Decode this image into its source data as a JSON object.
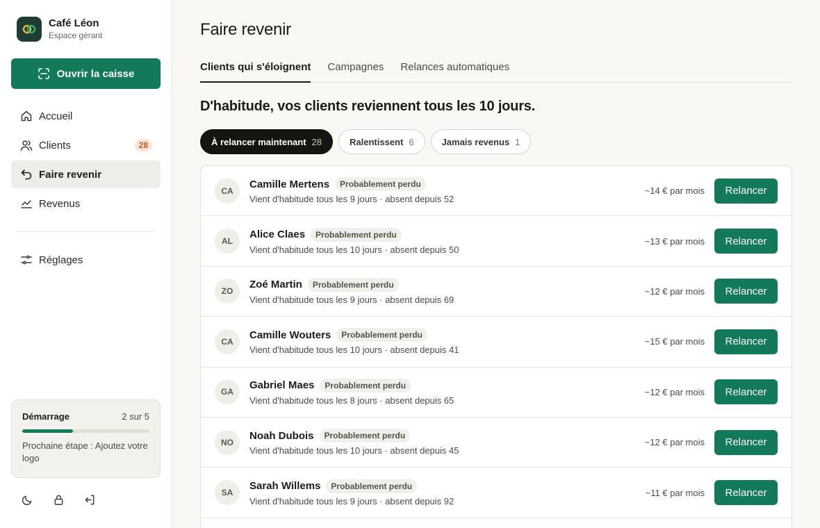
{
  "brand": {
    "name": "Café Léon",
    "subtitle": "Espace gérant",
    "colors": {
      "logo_bg": "#1f3d33",
      "accent": "#12795a"
    }
  },
  "cta": {
    "label": "Ouvrir la caisse",
    "icon": "scan-icon"
  },
  "nav": {
    "items": [
      {
        "label": "Accueil",
        "icon": "home-icon"
      },
      {
        "label": "Clients",
        "icon": "users-icon",
        "badge": "28"
      },
      {
        "label": "Faire revenir",
        "icon": "return-icon",
        "active": true
      },
      {
        "label": "Revenus",
        "icon": "chart-icon"
      }
    ],
    "settings": {
      "label": "Réglages",
      "icon": "sliders-icon"
    }
  },
  "onboarding": {
    "title": "Démarrage",
    "count": "2 sur 5",
    "progress": 0.4,
    "next": "Prochaine étape : Ajoutez votre logo"
  },
  "footer_icons": [
    "moon-icon",
    "lock-icon",
    "logout-icon"
  ],
  "page": {
    "title": "Faire revenir",
    "tabs": [
      {
        "label": "Clients qui s'éloignent",
        "active": true
      },
      {
        "label": "Campagnes"
      },
      {
        "label": "Relances automatiques"
      }
    ],
    "headline": "D'habitude, vos clients reviennent tous les 10 jours.",
    "filters": [
      {
        "label": "À relancer maintenant",
        "count": "28",
        "active": true
      },
      {
        "label": "Ralentissent",
        "count": "6"
      },
      {
        "label": "Jamais revenus",
        "count": "1"
      }
    ]
  },
  "clients": [
    {
      "initials": "CA",
      "name": "Camille Mertens",
      "tag": "Probablement perdu",
      "detail": "Vient d'habitude tous les 9 jours · absent depuis 52",
      "worth": "~14 € par mois",
      "action": "Relancer"
    },
    {
      "initials": "AL",
      "name": "Alice Claes",
      "tag": "Probablement perdu",
      "detail": "Vient d'habitude tous les 10 jours · absent depuis 50",
      "worth": "~13 € par mois",
      "action": "Relancer"
    },
    {
      "initials": "ZO",
      "name": "Zoé Martin",
      "tag": "Probablement perdu",
      "detail": "Vient d'habitude tous les 9 jours · absent depuis 69",
      "worth": "~12 € par mois",
      "action": "Relancer"
    },
    {
      "initials": "CA",
      "name": "Camille Wouters",
      "tag": "Probablement perdu",
      "detail": "Vient d'habitude tous les 10 jours · absent depuis 41",
      "worth": "~15 € par mois",
      "action": "Relancer"
    },
    {
      "initials": "GA",
      "name": "Gabriel Maes",
      "tag": "Probablement perdu",
      "detail": "Vient d'habitude tous les 8 jours · absent depuis 65",
      "worth": "~12 € par mois",
      "action": "Relancer"
    },
    {
      "initials": "NO",
      "name": "Noah Dubois",
      "tag": "Probablement perdu",
      "detail": "Vient d'habitude tous les 10 jours · absent depuis 45",
      "worth": "~12 € par mois",
      "action": "Relancer"
    },
    {
      "initials": "SA",
      "name": "Sarah Willems",
      "tag": "Probablement perdu",
      "detail": "Vient d'habitude tous les 9 jours · absent depuis 92",
      "worth": "~11 € par mois",
      "action": "Relancer"
    }
  ]
}
